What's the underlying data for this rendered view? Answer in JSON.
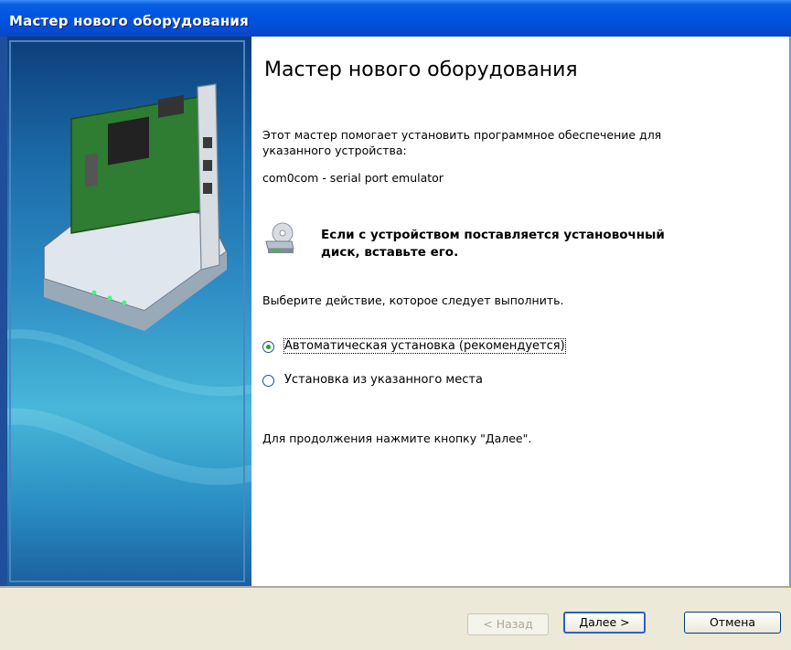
{
  "window": {
    "title": "Мастер нового оборудования"
  },
  "content": {
    "heading": "Мастер нового оборудования",
    "intro_line1": "Этот мастер помогает установить программное обеспечение для",
    "intro_line2": "указанного устройства:",
    "device_name": "com0com - serial port emulator",
    "cd_notice_line1": "Если с устройством поставляется установочный",
    "cd_notice_line2": "диск, вставьте его.",
    "choose_action": "Выберите действие, которое следует выполнить.",
    "options": [
      {
        "label": "Автоматическая установка (рекомендуется)",
        "selected": true
      },
      {
        "label": "Установка из указанного места",
        "selected": false
      }
    ],
    "continue_hint": "Для продолжения нажмите кнопку \"Далее\"."
  },
  "buttons": {
    "back": "< Назад",
    "next": "Далее >",
    "cancel": "Отмена"
  },
  "icons": {
    "left_banner": "network-card-icon",
    "cd": "cd-drive-icon"
  },
  "colors": {
    "titlebar": "#0054e3",
    "panel": "#2d8cc4",
    "radio_dot": "#21a121",
    "default_button_border": "#2e5ec9"
  }
}
